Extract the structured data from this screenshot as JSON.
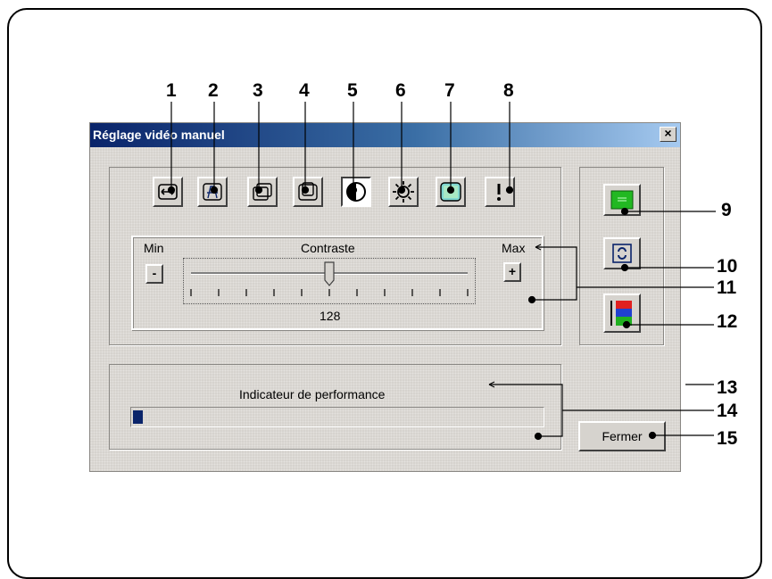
{
  "dialog": {
    "title": "Réglage vidéo manuel",
    "close_label": "×",
    "adjustment": {
      "label": "Contraste",
      "min_label": "Min",
      "max_label": "Max",
      "minus_label": "-",
      "plus_label": "+",
      "value": "128",
      "value_fraction": 0.5
    },
    "performance": {
      "label": "Indicateur de performance",
      "level_fraction": 0.025
    },
    "close_button_label": "Fermer"
  },
  "toolbar": {
    "buttons": [
      {
        "name": "horizontal-size-icon"
      },
      {
        "name": "trapezoid-icon"
      },
      {
        "name": "position-icon"
      },
      {
        "name": "size-icon"
      },
      {
        "name": "contrast-icon"
      },
      {
        "name": "brightness-icon"
      },
      {
        "name": "color-icon"
      },
      {
        "name": "reset-icon"
      }
    ]
  },
  "side_buttons": [
    {
      "name": "auto-adjust-icon"
    },
    {
      "name": "refresh-icon"
    },
    {
      "name": "test-pattern-icon"
    }
  ],
  "callouts": [
    "1",
    "2",
    "3",
    "4",
    "5",
    "6",
    "7",
    "8",
    "9",
    "10",
    "11",
    "12",
    "13",
    "14",
    "15"
  ],
  "colors": {
    "title_bar": "#0a246a",
    "dialog_bg": "#d6d3ce",
    "progress_fill": "#0a246a"
  }
}
